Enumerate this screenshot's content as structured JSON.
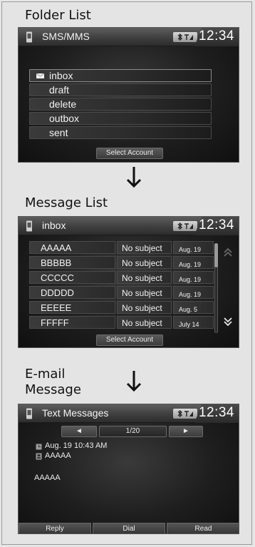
{
  "captions": {
    "folder_list": "Folder List",
    "message_list": "Message List",
    "email_message_line1": "E-mail",
    "email_message_line2": "Message"
  },
  "colors": {
    "screen_bg": "#1e1e1e",
    "topbar": "#4a4a4a",
    "text": "#f2f2f2",
    "status_badge": "#c8c8c8"
  },
  "folder_screen": {
    "title": "SMS/MMS",
    "clock": "12:34",
    "folders": [
      {
        "label": "inbox",
        "icon": "mail-icon",
        "selected": true
      },
      {
        "label": "draft"
      },
      {
        "label": "delete"
      },
      {
        "label": "outbox"
      },
      {
        "label": "sent"
      }
    ],
    "select_account": "Select Account"
  },
  "message_screen": {
    "title": "inbox",
    "clock": "12:34",
    "messages": [
      {
        "sender": "AAAAA",
        "subject": "No subject",
        "date": "Aug. 19"
      },
      {
        "sender": "BBBBB",
        "subject": "No subject",
        "date": "Aug. 19"
      },
      {
        "sender": "CCCCC",
        "subject": "No subject",
        "date": "Aug. 19"
      },
      {
        "sender": "DDDDD",
        "subject": "No subject",
        "date": "Aug. 19"
      },
      {
        "sender": "EEEEE",
        "subject": "No subject",
        "date": "Aug. 5"
      },
      {
        "sender": "FFFFF",
        "subject": "No subject",
        "date": "July 14"
      }
    ],
    "select_account": "Select Account"
  },
  "detail_screen": {
    "title": "Text Messages",
    "clock": "12:34",
    "page_indicator": "1/20",
    "prev_glyph": "◄",
    "next_glyph": "►",
    "timestamp": "Aug. 19 10:43 AM",
    "sender": "AAAAA",
    "body": "AAAAA",
    "actions": {
      "reply": "Reply",
      "dial": "Dial",
      "read": "Read"
    }
  }
}
